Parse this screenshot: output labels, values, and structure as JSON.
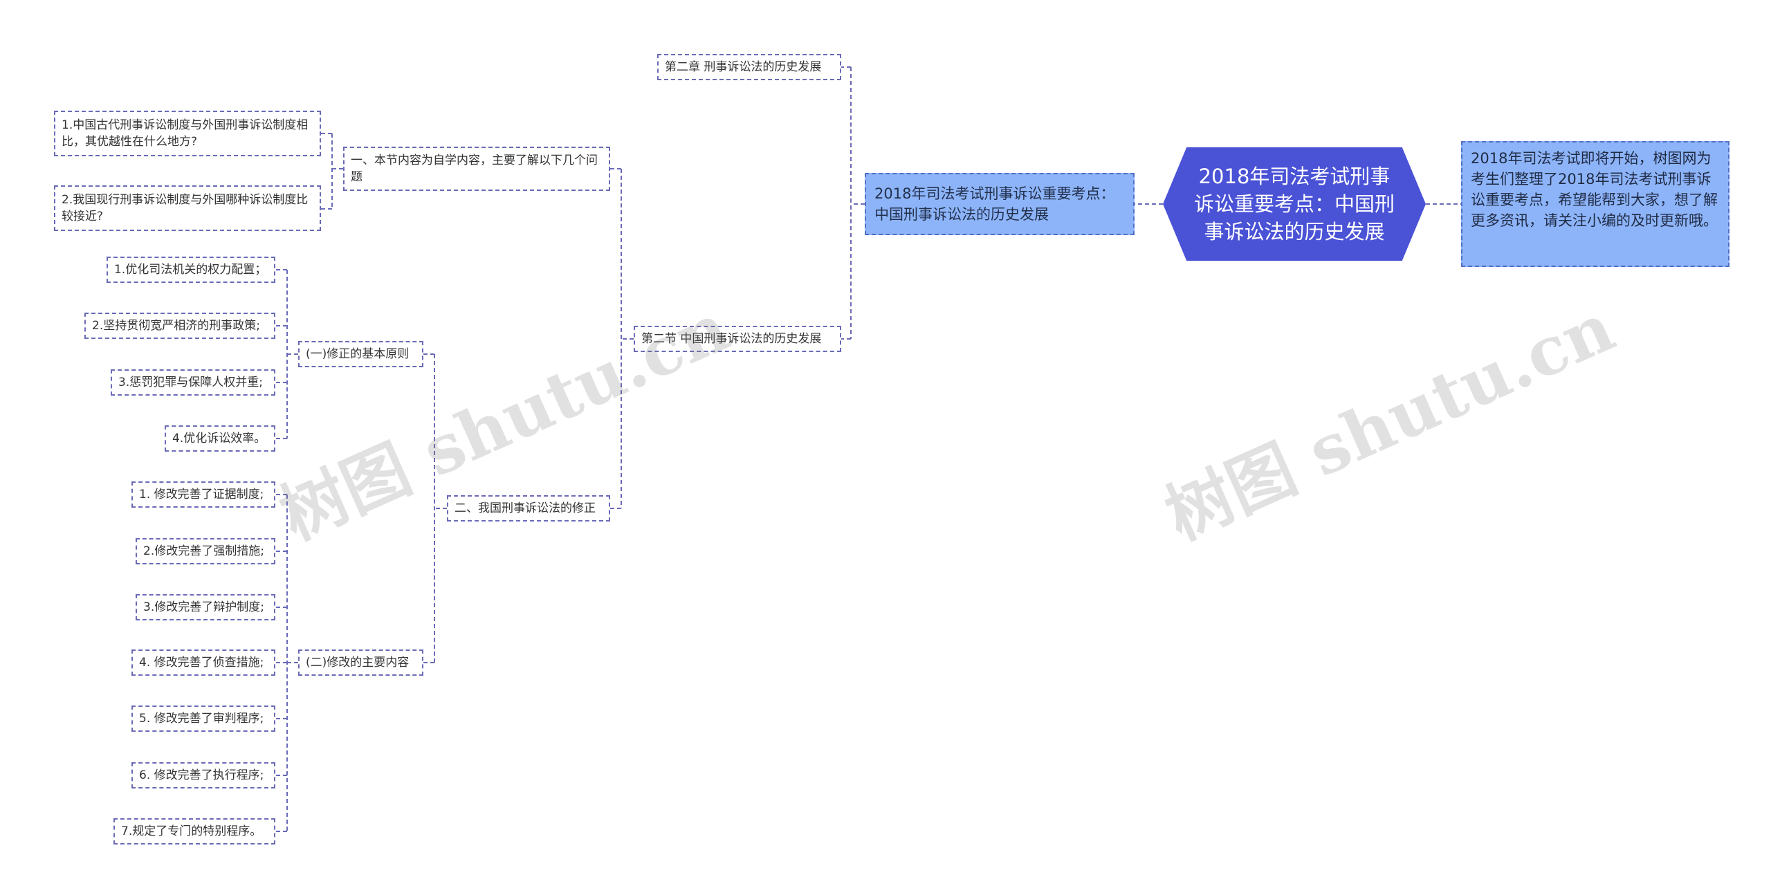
{
  "root": {
    "title": "2018年司法考试刑事诉讼重要考点：中国刑事诉讼法的历史发展"
  },
  "intro": {
    "text": "2018年司法考试即将开始，树图网为考生们整理了2018年司法考试刑事诉讼重要考点，希望能帮到大家，想了解更多资讯，请关注小编的及时更新哦。"
  },
  "level1": {
    "text": "2018年司法考试刑事诉讼重要考点：中国刑事诉讼法的历史发展"
  },
  "level2": {
    "chapter": "第二章 刑事诉讼法的历史发展",
    "section": "第二节 中国刑事诉讼法的历史发展"
  },
  "level3": {
    "self_study": "一、本节内容为自学内容，主要了解以下几个问题",
    "revision": "二、我国刑事诉讼法的修正"
  },
  "questions": [
    "1.中国古代刑事诉讼制度与外国刑事诉讼制度相比，其优越性在什么地方?",
    "2.我国现行刑事诉讼制度与外国哪种诉讼制度比较接近?"
  ],
  "level4": {
    "principles": "(一)修正的基本原则",
    "contents": "(二)修改的主要内容"
  },
  "principles": [
    "1.优化司法机关的权力配置；",
    "2.坚持贯彻宽严相济的刑事政策;",
    "3.惩罚犯罪与保障人权并重;",
    "4.优化诉讼效率。"
  ],
  "contents": [
    "1. 修改完善了证据制度;",
    "2.修改完善了强制措施;",
    "3.修改完善了辩护制度;",
    "4. 修改完善了侦查措施;",
    "5. 修改完善了审判程序;",
    "6. 修改完善了执行程序;",
    "7.规定了专门的特别程序。"
  ],
  "watermark": [
    "树图 shutu.cn",
    "树图 shutu.cn"
  ],
  "colors": {
    "root": "#4a52d6",
    "highlight": "#8db4f8",
    "connector": "#6a6ab8"
  }
}
